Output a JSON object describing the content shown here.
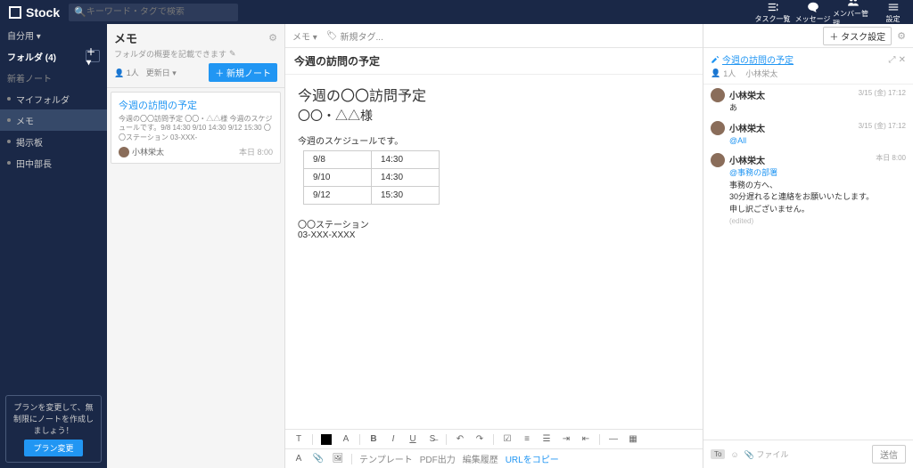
{
  "app": {
    "name": "Stock",
    "search_placeholder": "キーワード・タグで検索"
  },
  "topbar_items": [
    {
      "label": "タスク一覧"
    },
    {
      "label": "メッセージ"
    },
    {
      "label": "メンバー管理"
    },
    {
      "label": "設定"
    }
  ],
  "sidebar": {
    "self": "自分用 ▾",
    "folder_head": "フォルダ (4)",
    "recent": "新着ノート",
    "items": [
      "マイフォルダ",
      "メモ",
      "掲示板",
      "田中部長"
    ],
    "selected_index": 1,
    "plan_text": "プランを変更して、無制限にノートを作成しましょう！",
    "plan_btn": "プラン変更"
  },
  "notelist": {
    "title": "メモ",
    "desc": "フォルダの概要を記載できます",
    "people": "1人",
    "sort": "更新日 ▾",
    "new_btn": "＋ 新規ノート",
    "card": {
      "title": "今週の訪問の予定",
      "preview": "今週の〇〇訪問予定 〇〇・△△様 今週のスケジュールです。9/8 14:30 9/10 14:30 9/12 15:30 〇〇ステーション 03-XXX-",
      "user": "小林栄太",
      "date": "本日 8:00"
    }
  },
  "editor": {
    "tab": "メモ ▾",
    "tag_placeholder": "新規タグ...",
    "task_btn": "＋ タスク設定",
    "title": "今週の訪問の予定",
    "h2": "今週の〇〇訪問予定",
    "sub": "〇〇・△△様",
    "lbl": "今週のスケジュールです。",
    "table": [
      [
        "9/8",
        "14:30"
      ],
      [
        "9/10",
        "14:30"
      ],
      [
        "9/12",
        "15:30"
      ]
    ],
    "station": "〇〇ステーション",
    "phone": "03-XXX-XXXX",
    "footer_links": [
      "テンプレート",
      "PDF出力",
      "編集履歴",
      "URLをコピー"
    ]
  },
  "chat": {
    "title": "今週の訪問の予定",
    "people": "1人",
    "author": "小林栄太",
    "messages": [
      {
        "name": "小林栄太",
        "time": "3/15 (金) 17:12",
        "text": "あ"
      },
      {
        "name": "小林栄太",
        "time": "3/15 (金) 17:12",
        "mention": "@All"
      },
      {
        "name": "小林栄太",
        "time": "本日 8:00",
        "mention": "@事務の部署",
        "lines": [
          "事務の方へ、",
          "30分遅れると連絡をお願いいたします。",
          "申し訳ございません。"
        ],
        "edited": "(edited)"
      }
    ],
    "file_label": "ファイル",
    "send": "送信",
    "to": "To"
  }
}
